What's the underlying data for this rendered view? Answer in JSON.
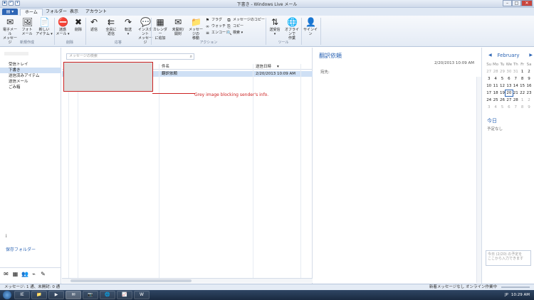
{
  "window": {
    "title": "下書き - Windows Live メール",
    "min": "–",
    "max": "□",
    "close": "✕"
  },
  "tabs": {
    "file": "▤ ▾",
    "items": [
      "ホーム",
      "フォルダー",
      "表示",
      "アカウント"
    ]
  },
  "ribbon": {
    "new_buttons": [
      {
        "label": "電子メール\nメッセージ",
        "icon": "mail-new-icon",
        "glyph": "✉"
      },
      {
        "label": "フォト\nメール",
        "icon": "photo-mail-icon",
        "glyph": "🖼"
      },
      {
        "label": "新しい\nアイテム ▾",
        "icon": "new-item-icon",
        "glyph": "📄"
      }
    ],
    "delete_buttons": [
      {
        "label": "迷惑\nメール ▾",
        "icon": "junk-icon",
        "glyph": "⛔"
      },
      {
        "label": "削除",
        "icon": "delete-icon",
        "glyph": "✖"
      }
    ],
    "respond_buttons": [
      {
        "label": "返信",
        "icon": "reply-icon",
        "glyph": "↶"
      },
      {
        "label": "全員に\n返信",
        "icon": "reply-all-icon",
        "glyph": "⇇"
      },
      {
        "label": "転送\n▾",
        "icon": "forward-icon",
        "glyph": "↷"
      },
      {
        "label": "インスタント\nメッセージ",
        "icon": "instant-message-icon",
        "glyph": "💬"
      }
    ],
    "action_buttons": [
      {
        "label": "カレンダー\nに追加",
        "icon": "calendar-add-icon",
        "glyph": "▦"
      },
      {
        "label": "未開封/\n開封",
        "icon": "read-unread-icon",
        "glyph": "✉"
      },
      {
        "label": "メッセージの\n移動",
        "icon": "move-icon",
        "glyph": "📁"
      }
    ],
    "action_small": [
      {
        "label": "フラグ",
        "icon": "flag-icon",
        "glyph": "⚑"
      },
      {
        "label": "ウォッチ",
        "icon": "watch-icon",
        "glyph": "∞"
      },
      {
        "label": "エンコード",
        "icon": "encode-icon",
        "glyph": "≡"
      }
    ],
    "copy_small": [
      {
        "label": "メッセージのコピー",
        "icon": "copy-message-icon",
        "glyph": "⧉"
      },
      {
        "label": "コピー",
        "icon": "copy-icon",
        "glyph": "⎘"
      },
      {
        "label": "検索 ▾",
        "icon": "find-icon",
        "glyph": "🔍"
      }
    ],
    "tool_buttons": [
      {
        "label": "送受信\n▾",
        "icon": "send-receive-icon",
        "glyph": "⇅"
      },
      {
        "label": "オフラインで\n作業",
        "icon": "offline-icon",
        "glyph": "🌐"
      }
    ],
    "signin": {
      "label": "サインイン",
      "icon": "signin-icon",
      "glyph": "👤"
    },
    "groups": {
      "new": "新規作成",
      "delete": "削除",
      "respond": "応答",
      "actions": "アクション",
      "tools": "ツール"
    }
  },
  "sidebar": {
    "folders": [
      "受信トレイ",
      "下書き",
      "送信済みアイテム",
      "送信メール",
      "ごみ箱"
    ],
    "selected": 1,
    "ci": "i",
    "safe": "保存フォルダー"
  },
  "list": {
    "search_placeholder": "メッセージの検索",
    "header": {
      "subject": "件名",
      "date": "送信日時"
    },
    "rows": [
      {
        "subject": "翻訳依頼",
        "date": "2/20/2013 10:09 AM"
      }
    ]
  },
  "annotation": "Grey image blocking sender's info.",
  "reading": {
    "subject": "翻訳依頼",
    "date": "2/20/2013 10:09 AM",
    "to": "宛先:"
  },
  "calendar": {
    "month": "February",
    "prev": "◀",
    "next": "▶",
    "dow": [
      "Su",
      "Mo",
      "Tu",
      "We",
      "Th",
      "Fr",
      "Sa"
    ],
    "days": [
      "27",
      "28",
      "29",
      "30",
      "31",
      "1",
      "2",
      "3",
      "4",
      "5",
      "6",
      "7",
      "8",
      "9",
      "10",
      "11",
      "12",
      "13",
      "14",
      "15",
      "16",
      "17",
      "18",
      "19",
      "20",
      "21",
      "22",
      "23",
      "24",
      "25",
      "26",
      "27",
      "28",
      "1",
      "2",
      "3",
      "4",
      "5",
      "6",
      "7",
      "8",
      "9"
    ],
    "today_label": "今日",
    "no_plans": "予定なし",
    "quick_add": "今日 (2/20) の予定を\nここから入力できます"
  },
  "status": {
    "left": "メッセージ: 1 通、未開封: 0 通",
    "right": "新着メッセージなし  オンライン作業中"
  },
  "taskbar": {
    "apps": [
      "IE",
      "📁",
      "▶",
      "✉",
      "📷",
      "🌐",
      "📈",
      "W"
    ],
    "lang": "JP",
    "time": "10:29 AM"
  }
}
